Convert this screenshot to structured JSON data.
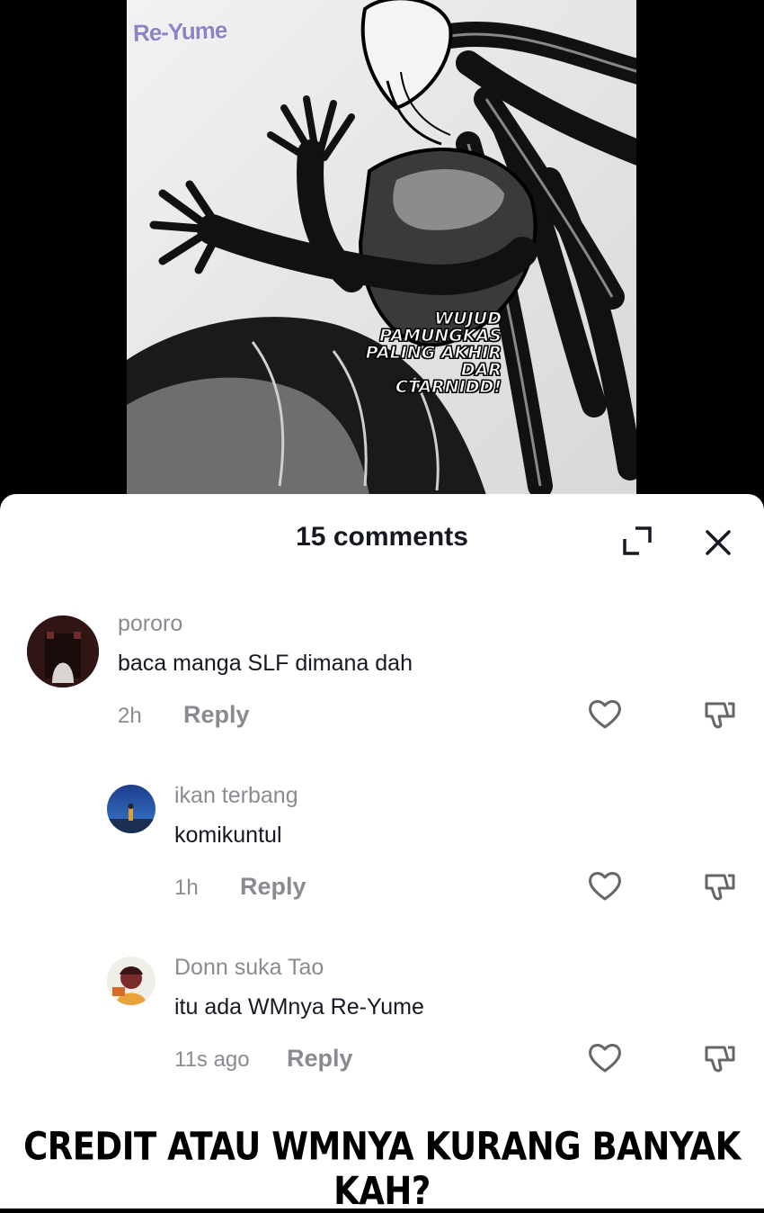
{
  "video": {
    "watermark": "Re-Yume",
    "caption_lines": [
      "WUJUD",
      "PAMUNGKAS",
      "PALING AKHIR DAR",
      "CTARNIDD!"
    ]
  },
  "sheet": {
    "title": "15 comments",
    "expand_icon": "expand-icon",
    "close_icon": "close-icon"
  },
  "comments": [
    {
      "username": "pororo",
      "text": "baca manga SLF dimana dah",
      "time": "2h",
      "reply": "Reply"
    },
    {
      "username": "ikan terbang",
      "text": "komikuntul",
      "time": "1h",
      "reply": "Reply"
    },
    {
      "username": "Donn suka Tao",
      "text": "itu ada WMnya Re-Yume",
      "time": "11s ago",
      "reply": "Reply"
    }
  ],
  "bottom_caption": "CREDIT ATAU WMNYA KURANG BANYAK KAH?"
}
